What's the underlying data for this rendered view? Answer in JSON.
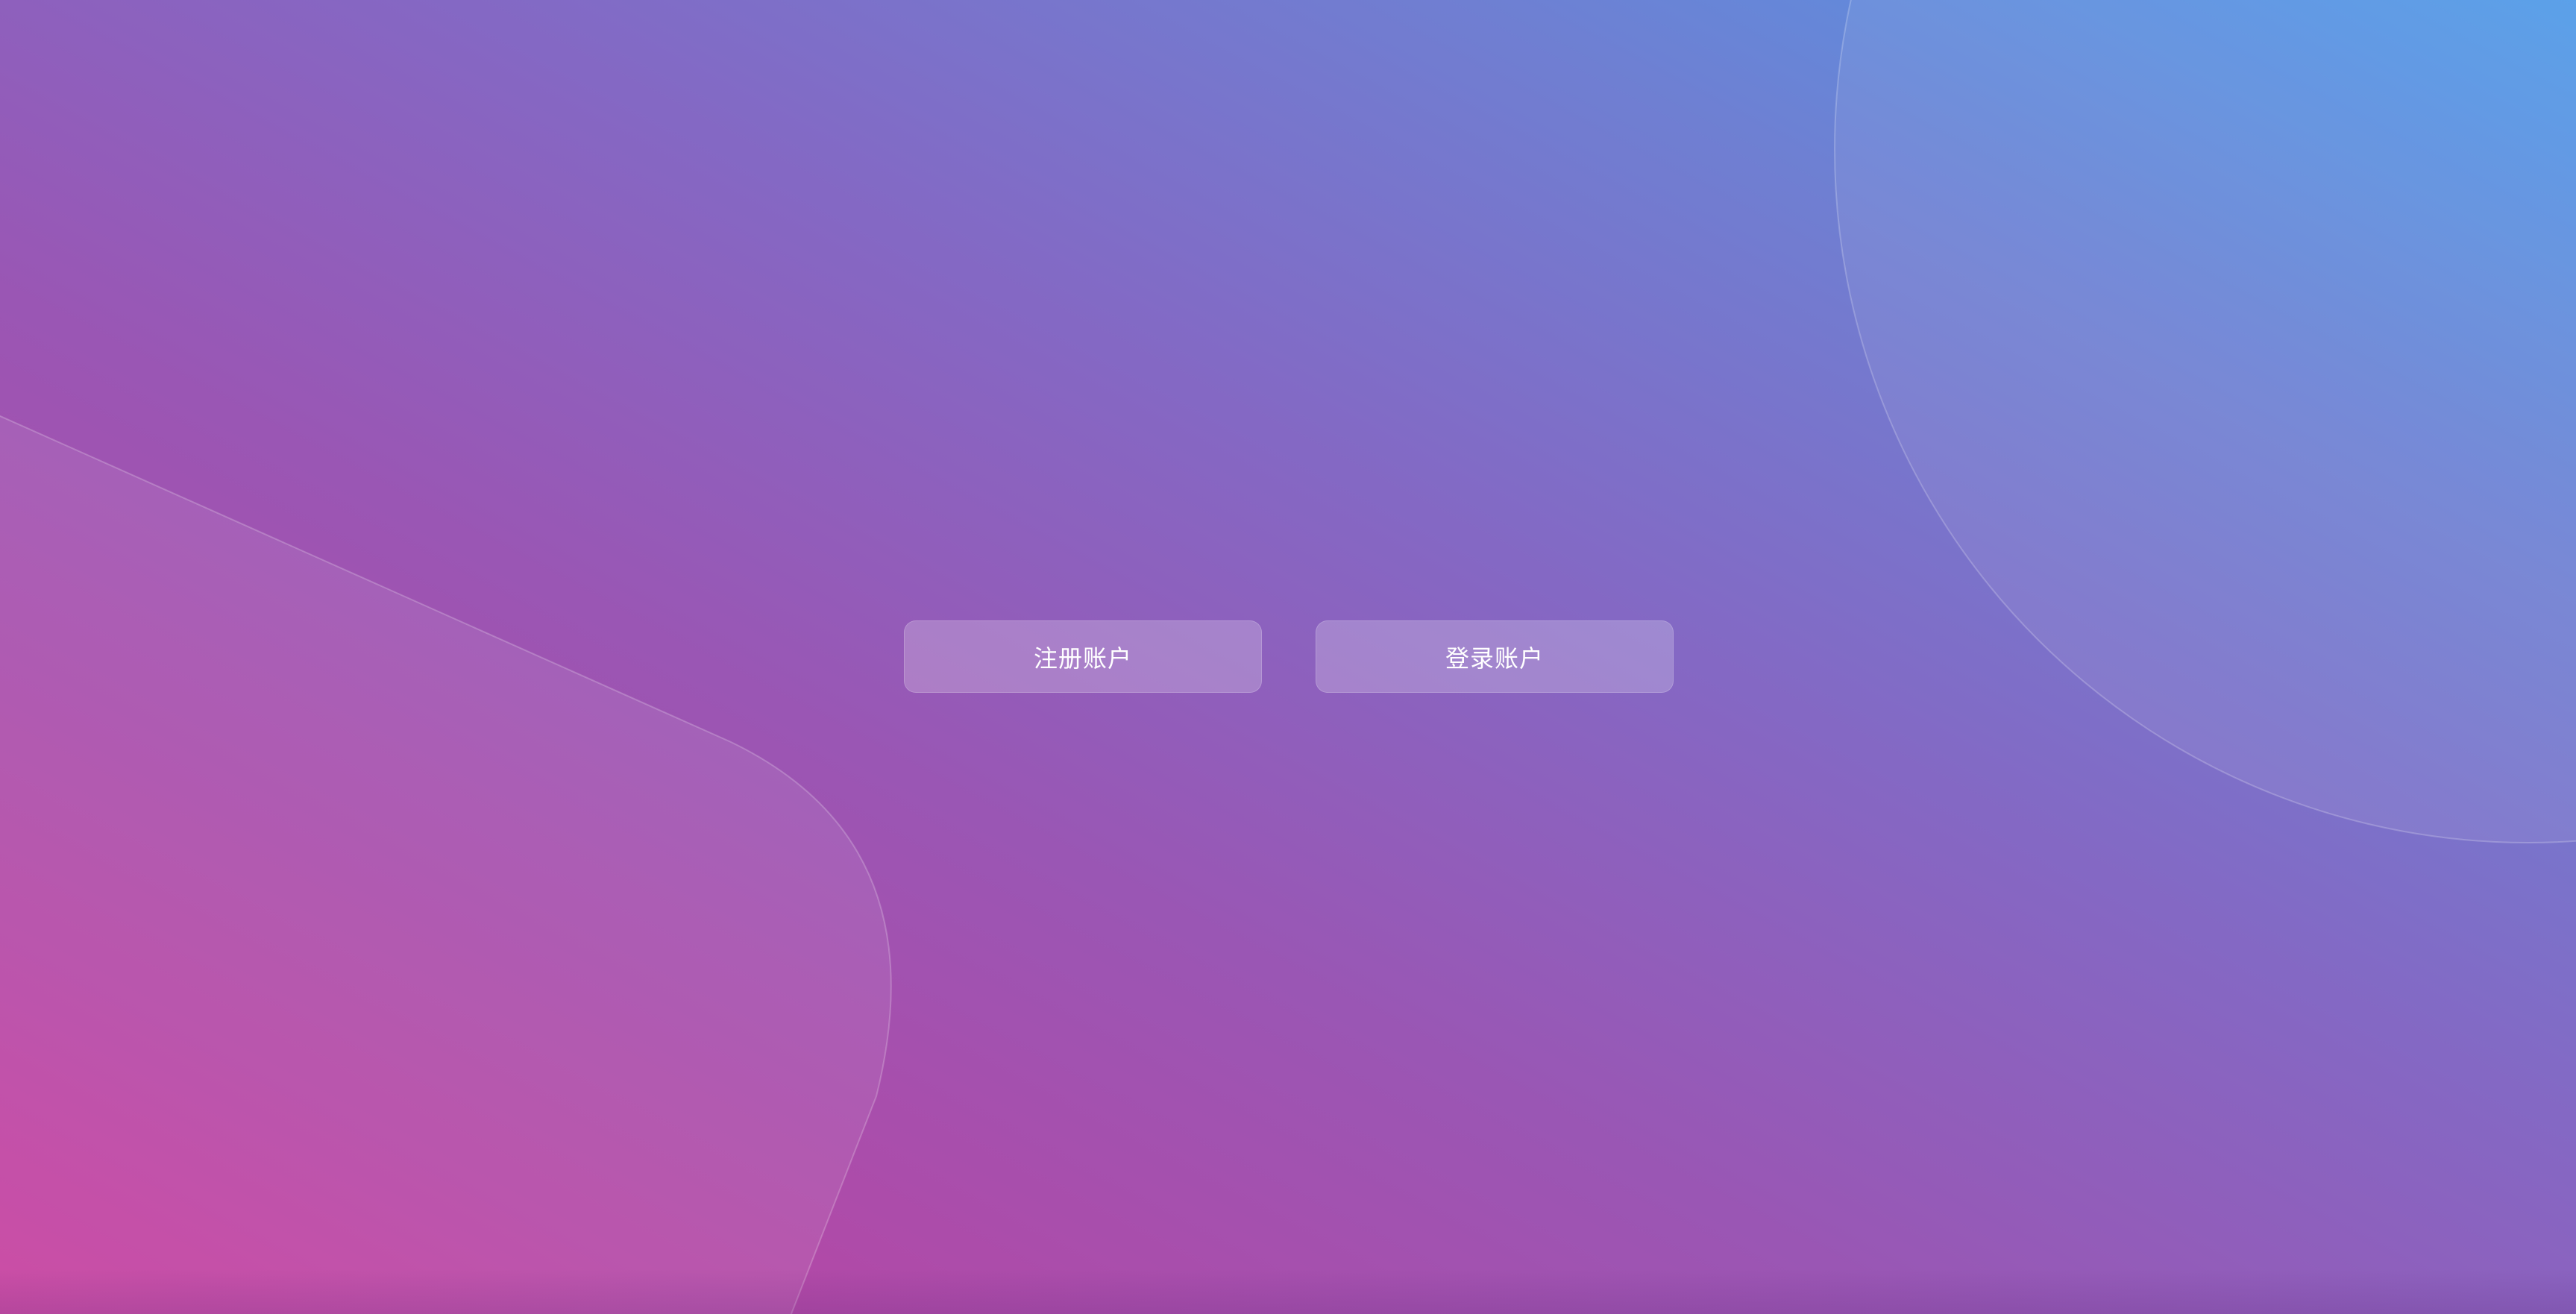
{
  "actions": {
    "register_label": "注册账户",
    "login_label": "登录账户"
  },
  "theme": {
    "gradient_start": "#4f9ae8",
    "gradient_mid": "#8468c4",
    "gradient_end": "#c83e9e",
    "button_text": "#ffffff"
  }
}
